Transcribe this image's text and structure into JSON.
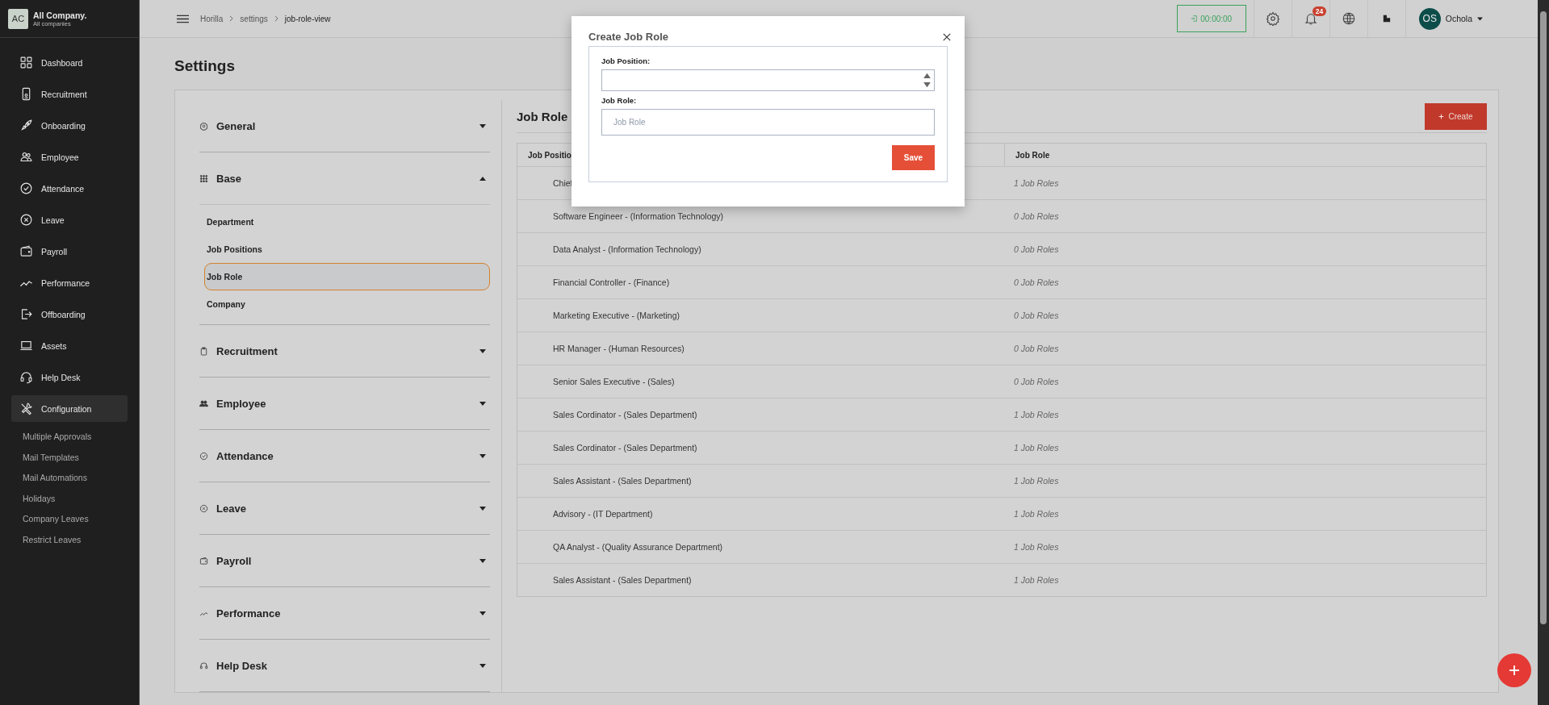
{
  "sidebar": {
    "company": {
      "initials": "AC",
      "name": "All Company.",
      "subtitle": "All companies"
    },
    "nav_items": [
      {
        "label": "Dashboard",
        "selected": false
      },
      {
        "label": "Recruitment",
        "selected": false
      },
      {
        "label": "Onboarding",
        "selected": false
      },
      {
        "label": "Employee",
        "selected": false
      },
      {
        "label": "Attendance",
        "selected": false
      },
      {
        "label": "Leave",
        "selected": false
      },
      {
        "label": "Payroll",
        "selected": false
      },
      {
        "label": "Performance",
        "selected": false
      },
      {
        "label": "Offboarding",
        "selected": false
      },
      {
        "label": "Assets",
        "selected": false
      },
      {
        "label": "Help Desk",
        "selected": false
      },
      {
        "label": "Configuration",
        "selected": true
      }
    ],
    "sub_items": [
      "Multiple Approvals",
      "Mail Templates",
      "Mail Automations",
      "Holidays",
      "Company Leaves",
      "Restrict Leaves"
    ]
  },
  "topbar": {
    "breadcrumbs": [
      "Horilla",
      "settings",
      "job-role-view"
    ],
    "timer": "00:00:00",
    "notification_count": "24",
    "user": {
      "initials": "OS",
      "name": "Ochola"
    }
  },
  "page_title": "Settings",
  "settings_menu": [
    {
      "label": "General",
      "expanded": false
    },
    {
      "label": "Base",
      "expanded": true,
      "items": [
        {
          "label": "Department",
          "selected": false
        },
        {
          "label": "Job Positions",
          "selected": false
        },
        {
          "label": "Job Role",
          "selected": true
        },
        {
          "label": "Company",
          "selected": false
        }
      ]
    },
    {
      "label": "Recruitment",
      "expanded": false
    },
    {
      "label": "Employee",
      "expanded": false
    },
    {
      "label": "Attendance",
      "expanded": false
    },
    {
      "label": "Leave",
      "expanded": false
    },
    {
      "label": "Payroll",
      "expanded": false
    },
    {
      "label": "Performance",
      "expanded": false
    },
    {
      "label": "Help Desk",
      "expanded": false
    }
  ],
  "job_role": {
    "title": "Job Role",
    "create_button": "Create",
    "table": {
      "columns": [
        "Job Positio",
        "Job Role"
      ],
      "rows": [
        {
          "position": "Chief",
          "roles": "1 Job Roles"
        },
        {
          "position": "Software Engineer - (Information Technology)",
          "roles": "0 Job Roles"
        },
        {
          "position": "Data Analyst - (Information Technology)",
          "roles": "0 Job Roles"
        },
        {
          "position": "Financial Controller - (Finance)",
          "roles": "0 Job Roles"
        },
        {
          "position": "Marketing Executive - (Marketing)",
          "roles": "0 Job Roles"
        },
        {
          "position": "HR Manager - (Human Resources)",
          "roles": "0 Job Roles"
        },
        {
          "position": "Senior Sales Executive - (Sales)",
          "roles": "0 Job Roles"
        },
        {
          "position": "Sales Cordinator - (Sales Department)",
          "roles": "1 Job Roles"
        },
        {
          "position": "Sales Cordinator - (Sales Department)",
          "roles": "1 Job Roles"
        },
        {
          "position": "Sales Assistant - (Sales Department)",
          "roles": "1 Job Roles"
        },
        {
          "position": "Advisory - (IT Department)",
          "roles": "1 Job Roles"
        },
        {
          "position": "QA Analyst - (Quality Assurance Department)",
          "roles": "1 Job Roles"
        },
        {
          "position": "Sales Assistant - (Sales Department)",
          "roles": "1 Job Roles"
        }
      ]
    }
  },
  "modal": {
    "title": "Create Job Role",
    "fields": [
      {
        "kind": "select",
        "label": "Job Position:"
      },
      {
        "kind": "text",
        "label": "Job Role:",
        "placeholder": "Job Role"
      }
    ],
    "save_button": "Save"
  }
}
